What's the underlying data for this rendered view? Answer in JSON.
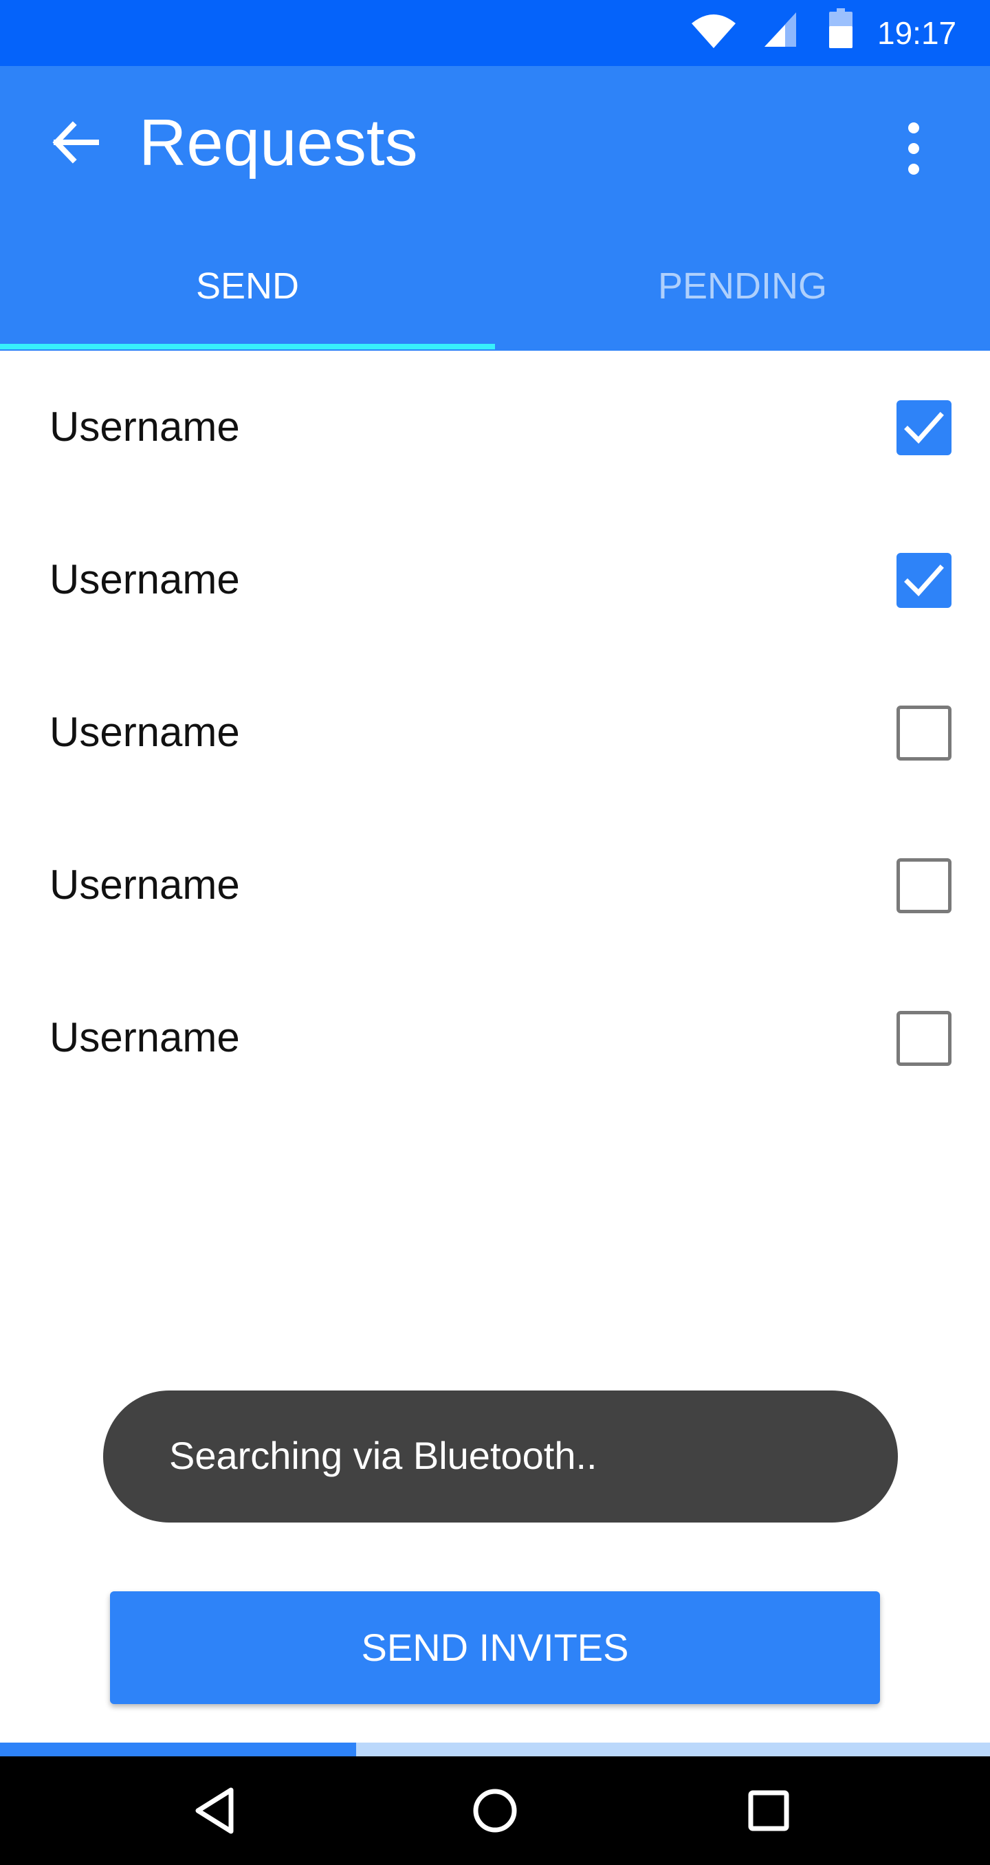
{
  "status_bar": {
    "time": "19:17",
    "icons": [
      "wifi-icon",
      "cellular-signal-icon",
      "battery-icon"
    ]
  },
  "app_bar": {
    "title": "Requests",
    "back_icon": "arrow-back-icon",
    "menu_icon": "more-vert-icon"
  },
  "tabs": [
    {
      "label": "SEND",
      "selected": true
    },
    {
      "label": "PENDING",
      "selected": false
    }
  ],
  "users": [
    {
      "label": "Username",
      "checked": true
    },
    {
      "label": "Username",
      "checked": true
    },
    {
      "label": "Username",
      "checked": false
    },
    {
      "label": "Username",
      "checked": false
    },
    {
      "label": "Username",
      "checked": false
    }
  ],
  "toast": {
    "text": "Searching via Bluetooth.."
  },
  "send_button": {
    "label": "SEND INVITES"
  },
  "progress": {
    "fraction": 0.36
  },
  "nav_bar": {
    "icons": [
      "back-triangle-icon",
      "home-circle-icon",
      "recents-square-icon"
    ]
  },
  "colors": {
    "status_bar": "#0563FA",
    "app_bar": "#2E83F8",
    "tab_indicator": "#37F0FB",
    "checkbox_checked": "#2E83F8",
    "toast_bg": "#424242",
    "progress_track": "#BBD8FB",
    "nav_bar": "#000000"
  }
}
